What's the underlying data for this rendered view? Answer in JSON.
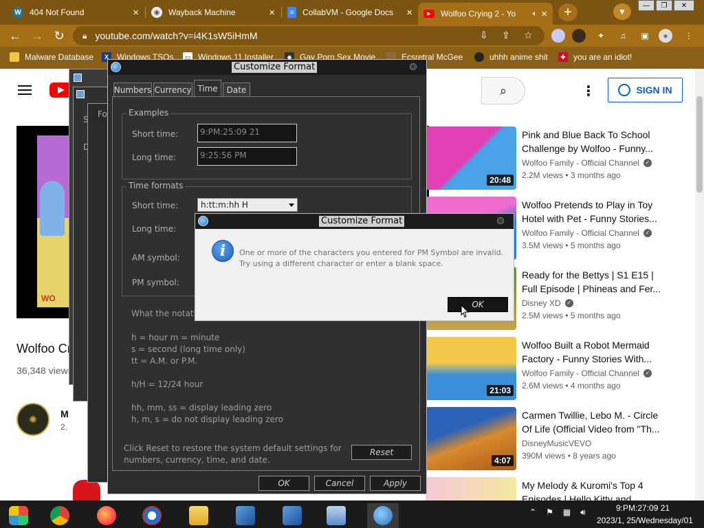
{
  "browser": {
    "tabs": [
      {
        "title": "404 Not Found",
        "icon": "wordpress-icon",
        "color": "#21759b"
      },
      {
        "title": "Wayback Machine",
        "icon": "globe-icon",
        "color": "#555555"
      },
      {
        "title": "CollabVM - Google Docs",
        "icon": "docs-icon",
        "color": "#4285f4"
      },
      {
        "title": "Wolfoo Crying 2 - Yo",
        "icon": "youtube-icon",
        "color": "#ff0000"
      }
    ],
    "new_tab": "+",
    "url": "youtube.com/watch?v=i4K1sW5iHmM",
    "bookmarks": [
      {
        "label": "Malware Database"
      },
      {
        "label": "Windows TSOs"
      },
      {
        "label": "Windows 11 Installer"
      },
      {
        "label": "Gay Porn Sex Movie"
      },
      {
        "label": "Ecsretral McGee"
      },
      {
        "label": "uhhh anime shit"
      },
      {
        "label": "you are an idiot!"
      }
    ]
  },
  "youtube": {
    "sign_in": "SIGN IN",
    "video_title": "Wolfoo Cry",
    "video_views": "36,348 views",
    "channel_initial": "M",
    "channel_subs": "2.",
    "player_brand": "WO",
    "recommendations": [
      {
        "title": "Pink and Blue Back To School Challenge by Wolfoo - Funny...",
        "channel": "Wolfoo Family - Official Channel",
        "meta": "2.2M views • 3 months ago",
        "duration": "20:48",
        "colors": [
          "#e23fb4",
          "#4aa3e8"
        ]
      },
      {
        "title": "Wolfoo Pretends to Play in Toy Hotel with Pet - Funny Stories...",
        "channel": "Wolfoo Family - Official Channel",
        "meta": "3.5M views • 5 months ago",
        "duration": "",
        "colors": [
          "#f06bd0",
          "#2a7fd6"
        ]
      },
      {
        "title": "Ready for the Bettys | S1 E15 | Full Episode | Phineas and Fer...",
        "channel": "Disney XD",
        "meta": "2.5M views • 5 months ago",
        "duration": "",
        "colors": [
          "#5c8a3a",
          "#c9a24a"
        ]
      },
      {
        "title": "Wolfoo Built a Robot Mermaid Factory - Funny Stories With...",
        "channel": "Wolfoo Family - Official Channel",
        "meta": "2.6M views • 4 months ago",
        "duration": "21:03",
        "colors": [
          "#f2c94c",
          "#3b8fd8"
        ]
      },
      {
        "title": "Carmen Twillie, Lebo M. - Circle Of Life (Official Video from \"Th...",
        "channel": "DisneyMusicVEVO",
        "meta": "390M views • 8 years ago",
        "duration": "4:07",
        "colors": [
          "#2b62b8",
          "#d98a2b"
        ]
      },
      {
        "title": "My Melody & Kuromi's Top 4 Episodes | Hello Kitty and...",
        "channel": "",
        "meta": "",
        "duration": "",
        "colors": [
          "#f7c8d8",
          "#f2e8a0"
        ]
      }
    ]
  },
  "dialog": {
    "title": "Customize Format",
    "tabs": [
      "Numbers",
      "Currency",
      "Time",
      "Date"
    ],
    "active_tab": "Time",
    "examples_label": "Examples",
    "short_time_label": "Short time:",
    "short_time_value": "9:PM:25:09 21",
    "long_time_label": "Long time:",
    "long_time_value": "9:25:56 PM",
    "formats_label": "Time formats",
    "short_time_format": "h:tt:m:hh H",
    "long_time_format_label": "Long time:",
    "am_label": "AM symbol:",
    "pm_label": "PM symbol:",
    "notation_heading": "What the notati",
    "notation_lines": [
      "h = hour   m = minute",
      "s = second (long time only)",
      "tt = A.M. or P.M.",
      "",
      "h/H = 12/24 hour",
      "",
      "hh, mm, ss = display leading zero",
      "h, m, s = do not display leading zero"
    ],
    "reset_note_1": "Click Reset to restore the system default settings for",
    "reset_note_2": "numbers, currency, time, and date.",
    "reset_button": "Reset",
    "ok_button": "OK",
    "cancel_button": "Cancel",
    "apply_button": "Apply"
  },
  "message_box": {
    "title": "Customize Format",
    "line1": "One or more of the characters you entered for PM Symbol are invalid.",
    "line2": "Try using a different character or enter a blank space.",
    "ok_button": "OK"
  },
  "background_windows": {
    "fragment_1": "Fo",
    "fragment_2": "S",
    "fragment_3": "D"
  },
  "taskbar": {
    "clock_time": "9:PM:27:09 21",
    "clock_date": "2023/1, 25/Wednesday/01"
  }
}
